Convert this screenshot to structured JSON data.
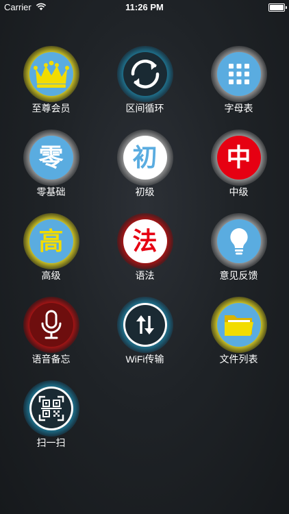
{
  "status_bar": {
    "carrier": "Carrier",
    "time": "11:26 PM",
    "icons": [
      "wifi-icon",
      "battery-icon"
    ]
  },
  "colors": {
    "background": "#1f2327",
    "tile_blue": "#5aace0",
    "tile_red": "#e60012",
    "tile_yellow": "#f2dc00",
    "glow_yellow": "#d2c828",
    "glow_red": "#aa1414",
    "glow_teal": "#1e7896",
    "glow_gray": "#969696"
  },
  "tiles": [
    {
      "label": "至尊会员",
      "icon": "crown-icon"
    },
    {
      "label": "区间循环",
      "icon": "loop-icon"
    },
    {
      "label": "字母表",
      "icon": "grid-icon"
    },
    {
      "label": "零基础",
      "icon": "ling-character-icon",
      "glyph": "零"
    },
    {
      "label": "初级",
      "icon": "chu-character-icon",
      "glyph": "初"
    },
    {
      "label": "中级",
      "icon": "zhong-character-icon",
      "glyph": "中"
    },
    {
      "label": "高级",
      "icon": "gao-character-icon",
      "glyph": "高"
    },
    {
      "label": "语法",
      "icon": "fa-character-icon",
      "glyph": "法"
    },
    {
      "label": "意见反馈",
      "icon": "lightbulb-icon"
    },
    {
      "label": "语音备忘",
      "icon": "microphone-icon"
    },
    {
      "label": "WiFi传输",
      "icon": "transfer-arrows-icon"
    },
    {
      "label": "文件列表",
      "icon": "folder-icon"
    },
    {
      "label": "扫一扫",
      "icon": "qr-scan-icon"
    }
  ]
}
